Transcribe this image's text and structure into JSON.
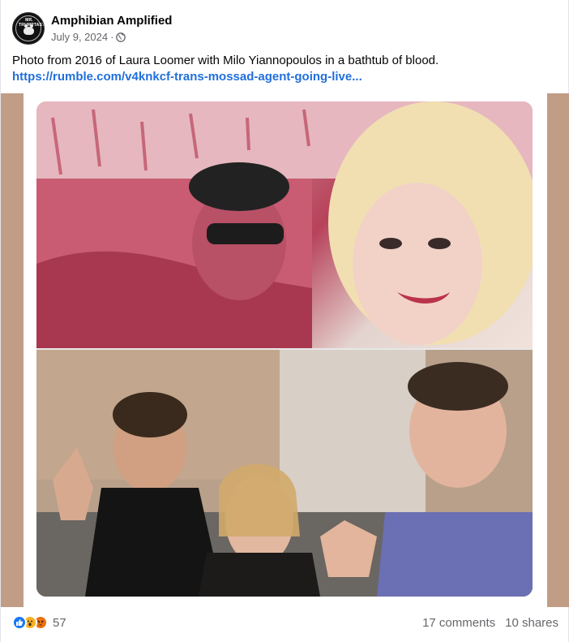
{
  "post": {
    "author": "Amphibian Amplified",
    "date": "July 9, 2024",
    "separator": "·",
    "avatar_text": "MR. TRUMPTASTIC",
    "text": "Photo from 2016 of Laura Loomer with Milo Yiannopoulos in a bathtub of blood.",
    "link": "https://rumble.com/v4knkcf-trans-mossad-agent-going-live..."
  },
  "footer": {
    "reaction_count": "57",
    "comments": "17 comments",
    "shares": "10 shares"
  },
  "icons": {
    "privacy": "globe-icon",
    "reactions": [
      "like-icon",
      "wow-icon",
      "angry-icon"
    ]
  },
  "colors": {
    "link": "#216fdb",
    "like": "#1877f2",
    "wow": "#f7b125",
    "angry": "#e9710f",
    "muted": "#65676b"
  }
}
